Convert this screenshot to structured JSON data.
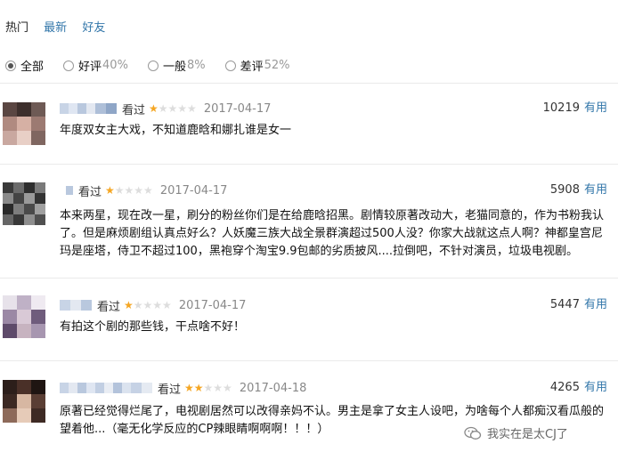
{
  "tabs": {
    "hot": "热门",
    "latest": "最新",
    "friends": "好友"
  },
  "filters": {
    "all": "全部",
    "good": "好评",
    "good_pct": "40%",
    "mid": "一般",
    "mid_pct": "8%",
    "bad": "差评",
    "bad_pct": "52%"
  },
  "reviews": [
    {
      "action": "看过",
      "rating": 1,
      "date": "2017-04-17",
      "votes": "10219",
      "useful": "有用",
      "text": "年度双女主大戏，不知道鹿晗和娜扎谁是女一"
    },
    {
      "action": "看过",
      "rating": 1,
      "date": "2017-04-17",
      "votes": "5908",
      "useful": "有用",
      "text": "本来两星，现在改一星，刷分的粉丝你们是在给鹿晗招黑。剧情较原著改动大，老猫同意的，作为书粉我认了。但是麻烦剧组认真点好么？人妖魔三族大战全景群演超过500人没？你家大战就这点人啊？神都皇宫尼玛是座塔，侍卫不超过100，黑袍穿个淘宝9.9包邮的劣质披风....拉倒吧，不针对演员，垃圾电视剧。"
    },
    {
      "action": "看过",
      "rating": 1,
      "date": "2017-04-17",
      "votes": "5447",
      "useful": "有用",
      "text": "有拍这个剧的那些钱，干点啥不好！"
    },
    {
      "action": "看过",
      "rating": 2,
      "date": "2017-04-18",
      "votes": "4265",
      "useful": "有用",
      "text": "原著已经觉得烂尾了，电视剧居然可以改得亲妈不认。男主是拿了女主人设吧，为啥每个人都痴汉看瓜般的望着他...（毫无化学反应的CP辣眼睛啊啊啊！！！）"
    }
  ],
  "watermark": "我实在是太CJ了"
}
